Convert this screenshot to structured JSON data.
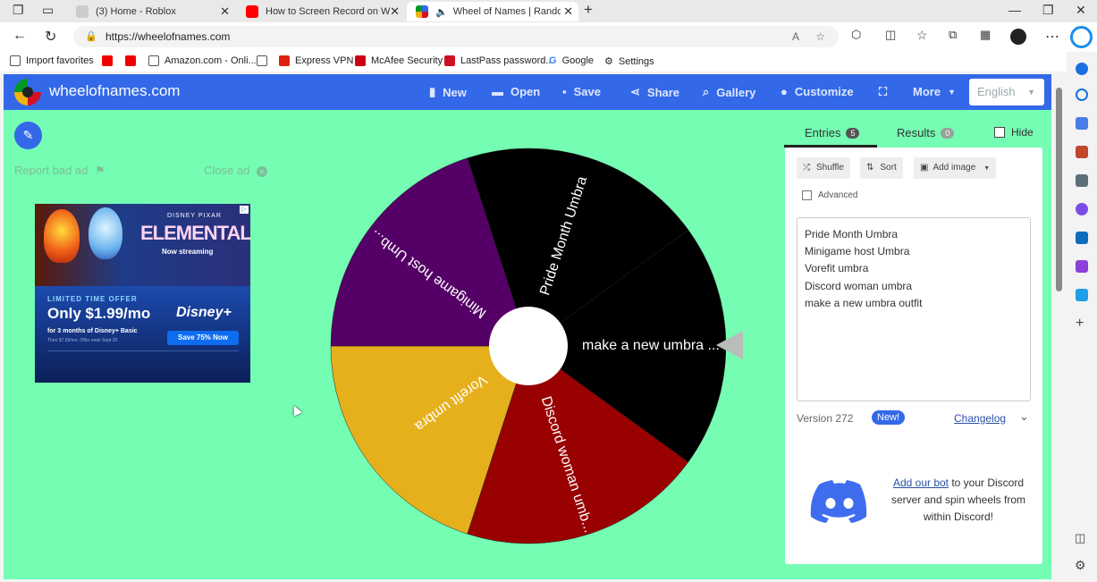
{
  "browser": {
    "tabs": [
      {
        "title": "(3) Home - Roblox"
      },
      {
        "title": "How to Screen Record on Windo"
      },
      {
        "title": "Wheel of Names | Random"
      }
    ],
    "url": "https://wheelofnames.com",
    "bookmarks": [
      {
        "label": "Import favorites"
      },
      {
        "label": "Amazon.com - Onli..."
      },
      {
        "label": "Express VPN"
      },
      {
        "label": "McAfee Security"
      },
      {
        "label": "LastPass password..."
      },
      {
        "label": "Google"
      },
      {
        "label": "Settings"
      }
    ]
  },
  "app": {
    "site_name": "wheelofnames.com",
    "toolbar": {
      "new": "New",
      "open": "Open",
      "save": "Save",
      "share": "Share",
      "gallery": "Gallery",
      "customize": "Customize",
      "more": "More",
      "language": "English"
    },
    "report_ad": "Report bad ad",
    "close_ad": "Close ad",
    "ad": {
      "brand": "DISNEY PIXAR",
      "movie": "ELEMENTAL",
      "status": "Now streaming",
      "offer_label": "LIMITED TIME OFFER",
      "price": "Only $1.99/mo",
      "terms": "for 3 months of Disney+ Basic",
      "terms2": "Then $7.99/mo. Offer ends Sept 20.",
      "cta": "Save 75% Now",
      "logo": "Disney+"
    },
    "wheel": {
      "segments": [
        {
          "label": "Pride Month Umbra",
          "color": "#000000"
        },
        {
          "label": "make a new umbra ...",
          "color": "#000000"
        },
        {
          "label": "Discord woman umb...",
          "color": "#990000"
        },
        {
          "label": "Vorefit umbra",
          "color": "#e6b01d"
        },
        {
          "label": "Minigame host Umb...",
          "color": "#550066"
        }
      ]
    },
    "panel": {
      "tab_entries": "Entries",
      "entries_count": "5",
      "tab_results": "Results",
      "results_count": "0",
      "hide": "Hide",
      "shuffle": "Shuffle",
      "sort": "Sort",
      "add_image": "Add image",
      "advanced": "Advanced",
      "entries": [
        "Pride Month Umbra",
        "Minigame host Umbra",
        "Vorefit umbra",
        "Discord woman umbra",
        "make a new umbra outfit"
      ],
      "version": "Version 272",
      "new_badge": "New!",
      "changelog": "Changelog",
      "discord_link": "Add our bot",
      "discord_text1": " to your Discord",
      "discord_text2": "server and spin wheels from",
      "discord_text3": "within Discord!"
    }
  }
}
